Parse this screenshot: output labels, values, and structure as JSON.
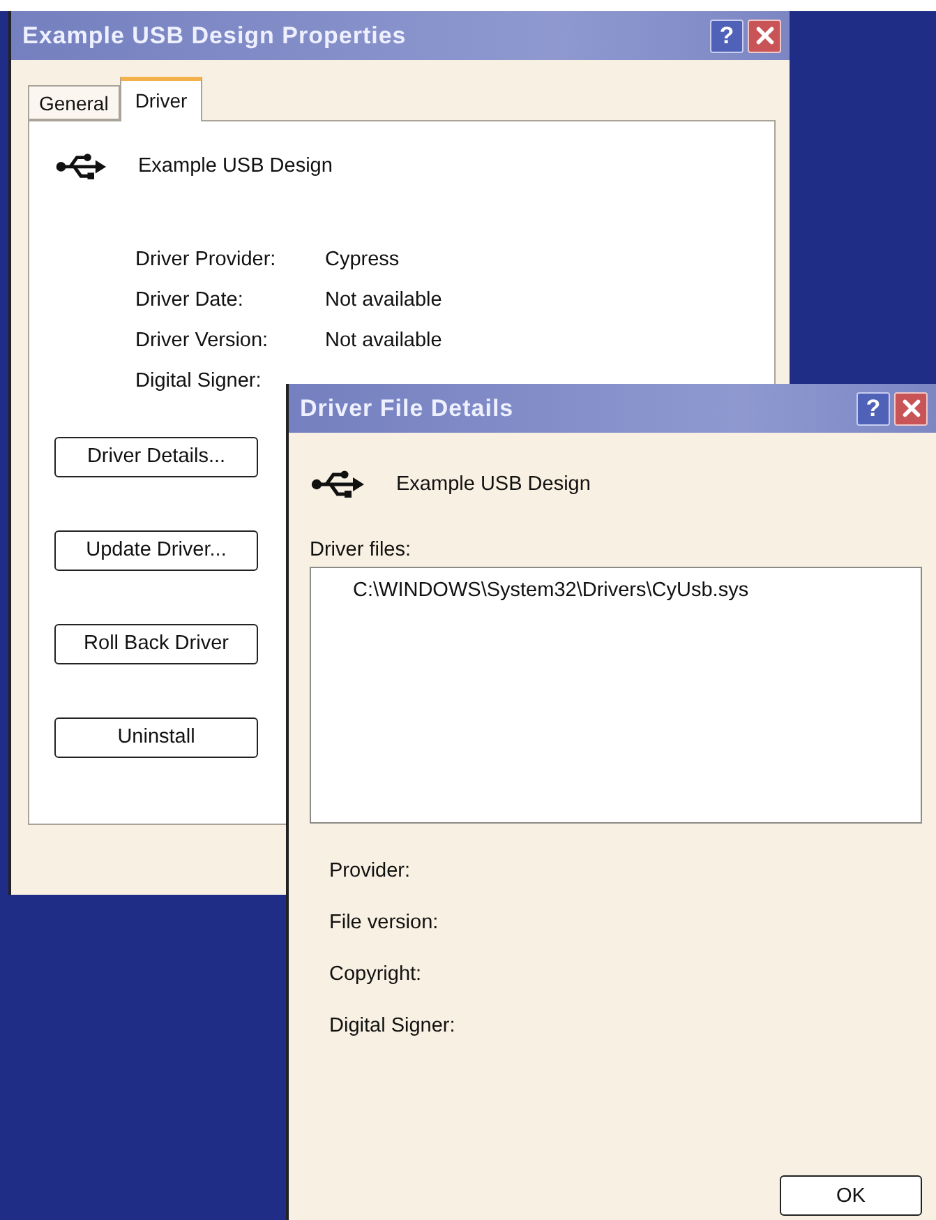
{
  "back_window": {
    "title": "Example USB Design Properties",
    "help": "?",
    "tabs": [
      {
        "label": "General",
        "selected": false
      },
      {
        "label": "Driver",
        "selected": true
      }
    ],
    "device_name": "Example USB Design",
    "details": [
      {
        "label": "Driver Provider:",
        "value": "Cypress"
      },
      {
        "label": "Driver Date:",
        "value": "Not available"
      },
      {
        "label": "Driver Version:",
        "value": "Not available"
      },
      {
        "label": "Digital Signer:"
      }
    ],
    "buttons": [
      "Driver Details...",
      "Update Driver...",
      "Roll Back Driver",
      "Uninstall"
    ]
  },
  "front_window": {
    "title": "Driver File Details",
    "help": "?",
    "device_name": "Example USB Design",
    "files_label": "Driver files:",
    "files": [
      "C:\\WINDOWS\\System32\\Drivers\\CyUsb.sys"
    ],
    "details": [
      "Provider:",
      "File version:",
      "Copyright:",
      "Digital Signer:"
    ],
    "ok_button": "OK"
  }
}
